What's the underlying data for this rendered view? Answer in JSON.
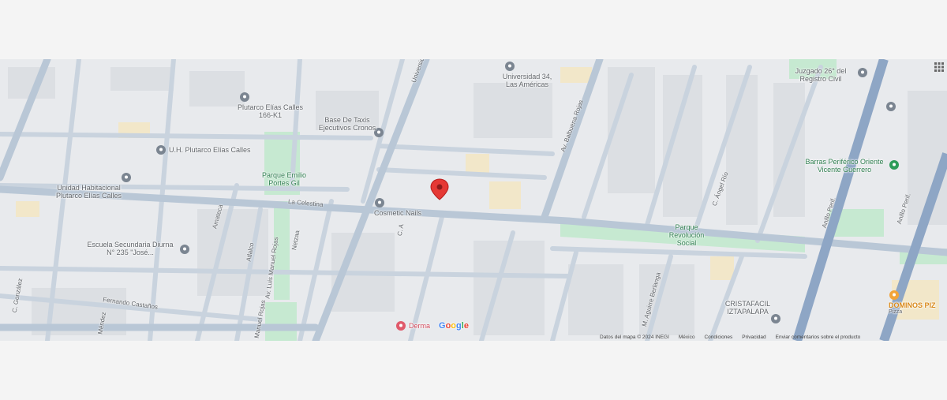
{
  "map": {
    "marker_label": "",
    "places": {
      "universidad34": "Universidad 34, Las Américas",
      "plutarco_calles": "Plutarco Elías Calles 166-K1",
      "base_taxis": "Base De Taxis Ejecutivos Cronos",
      "uh_plutarco": "U.H. Plutarco Elías Calles",
      "parque_emilio": "Parque Emilio Portes Gil",
      "unidad_habitacional": "Unidad Habitacional Plutarco Elías Calles",
      "cosmetic_nails": "Cosmetic Nails",
      "escuela": "Escuela Secundaria Diurna N° 235 \"José...",
      "juzgado": "Juzgado 26° del Registro Civil",
      "barras": "Barras Periférico Oriente Vicente Guerrero",
      "parque_revolucion": "Parque Revolución Social",
      "cristafacil": "CRISTAFACIL IZTAPALAPA",
      "dominos": "DOMINOS PIZ",
      "dominos_sub": "Pizza",
      "derma": "Derma"
    },
    "streets": {
      "la_celestina": "La Celestina",
      "fernando_castanos": "Fernando Castaños",
      "universidad": "Universidad",
      "av_balbuena": "Av. Balbuena Rojas",
      "anillo_peri": "Anillo Perif.",
      "anillo_peri2": "Anillo Perif.",
      "amatecas": "Amateca",
      "atlalco": "Atlalco",
      "av_luis_manuel": "Av. Luis Manuel Rojas",
      "netzaa": "Netzaa",
      "c_a": "C. A",
      "c_rio": "C. Ángel Río",
      "m_aguirre": "M. Aguirre Berlanga",
      "manuel_rojas": "Manuel Rojas",
      "mendez": "Méndez",
      "gonzalez": "C. González"
    },
    "brand": "Google"
  },
  "footer": {
    "datos": "Datos del mapa © 2024 INEGI",
    "mexico": "México",
    "condiciones": "Condiciones",
    "privacidad": "Privacidad",
    "enviar": "Enviar comentarios sobre el producto"
  },
  "colors": {
    "road": "#c5d0dc",
    "block": "#dfe1e5",
    "park": "#bfe6cc",
    "highway": "#8fa7c4",
    "marker": "#e53935"
  }
}
